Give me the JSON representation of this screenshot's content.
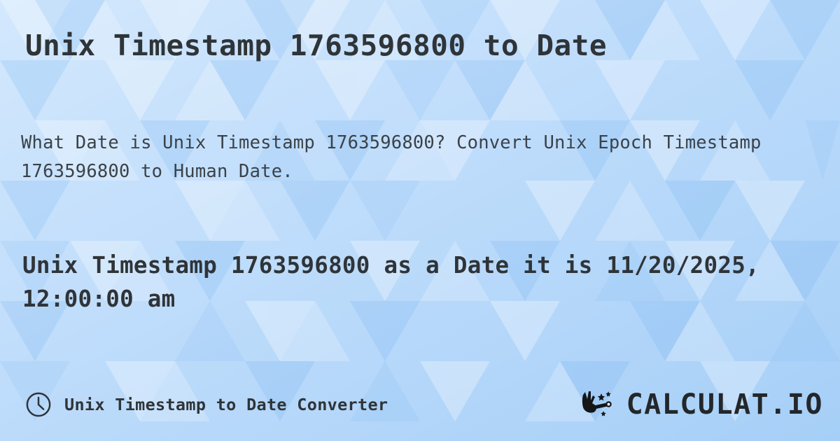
{
  "page": {
    "title": "Unix Timestamp 1763596800 to Date",
    "description": "What Date is Unix Timestamp 1763596800? Convert Unix Epoch Timestamp 1763596800 to Human Date.",
    "result": "Unix Timestamp 1763596800 as a Date it is 11/20/2025, 12:00:00 am"
  },
  "values": {
    "timestamp": "1763596800",
    "human_date": "11/20/2025, 12:00:00 am",
    "date_part": "11/20/2025",
    "time_part": "12:00:00 am"
  },
  "footer": {
    "clock_icon": "clock-icon",
    "label": "Unix Timestamp to Date Converter",
    "brand_icon": "magic-wand-hand-icon",
    "brand_name": "CALCULAT.IO"
  },
  "colors": {
    "background_light": "#cfe6fd",
    "background_mid": "#bcdcfb",
    "background_dark": "#a9d1f7",
    "text_primary": "#2f3438",
    "text_secondary": "#3b4248",
    "brand": "#23272b"
  }
}
